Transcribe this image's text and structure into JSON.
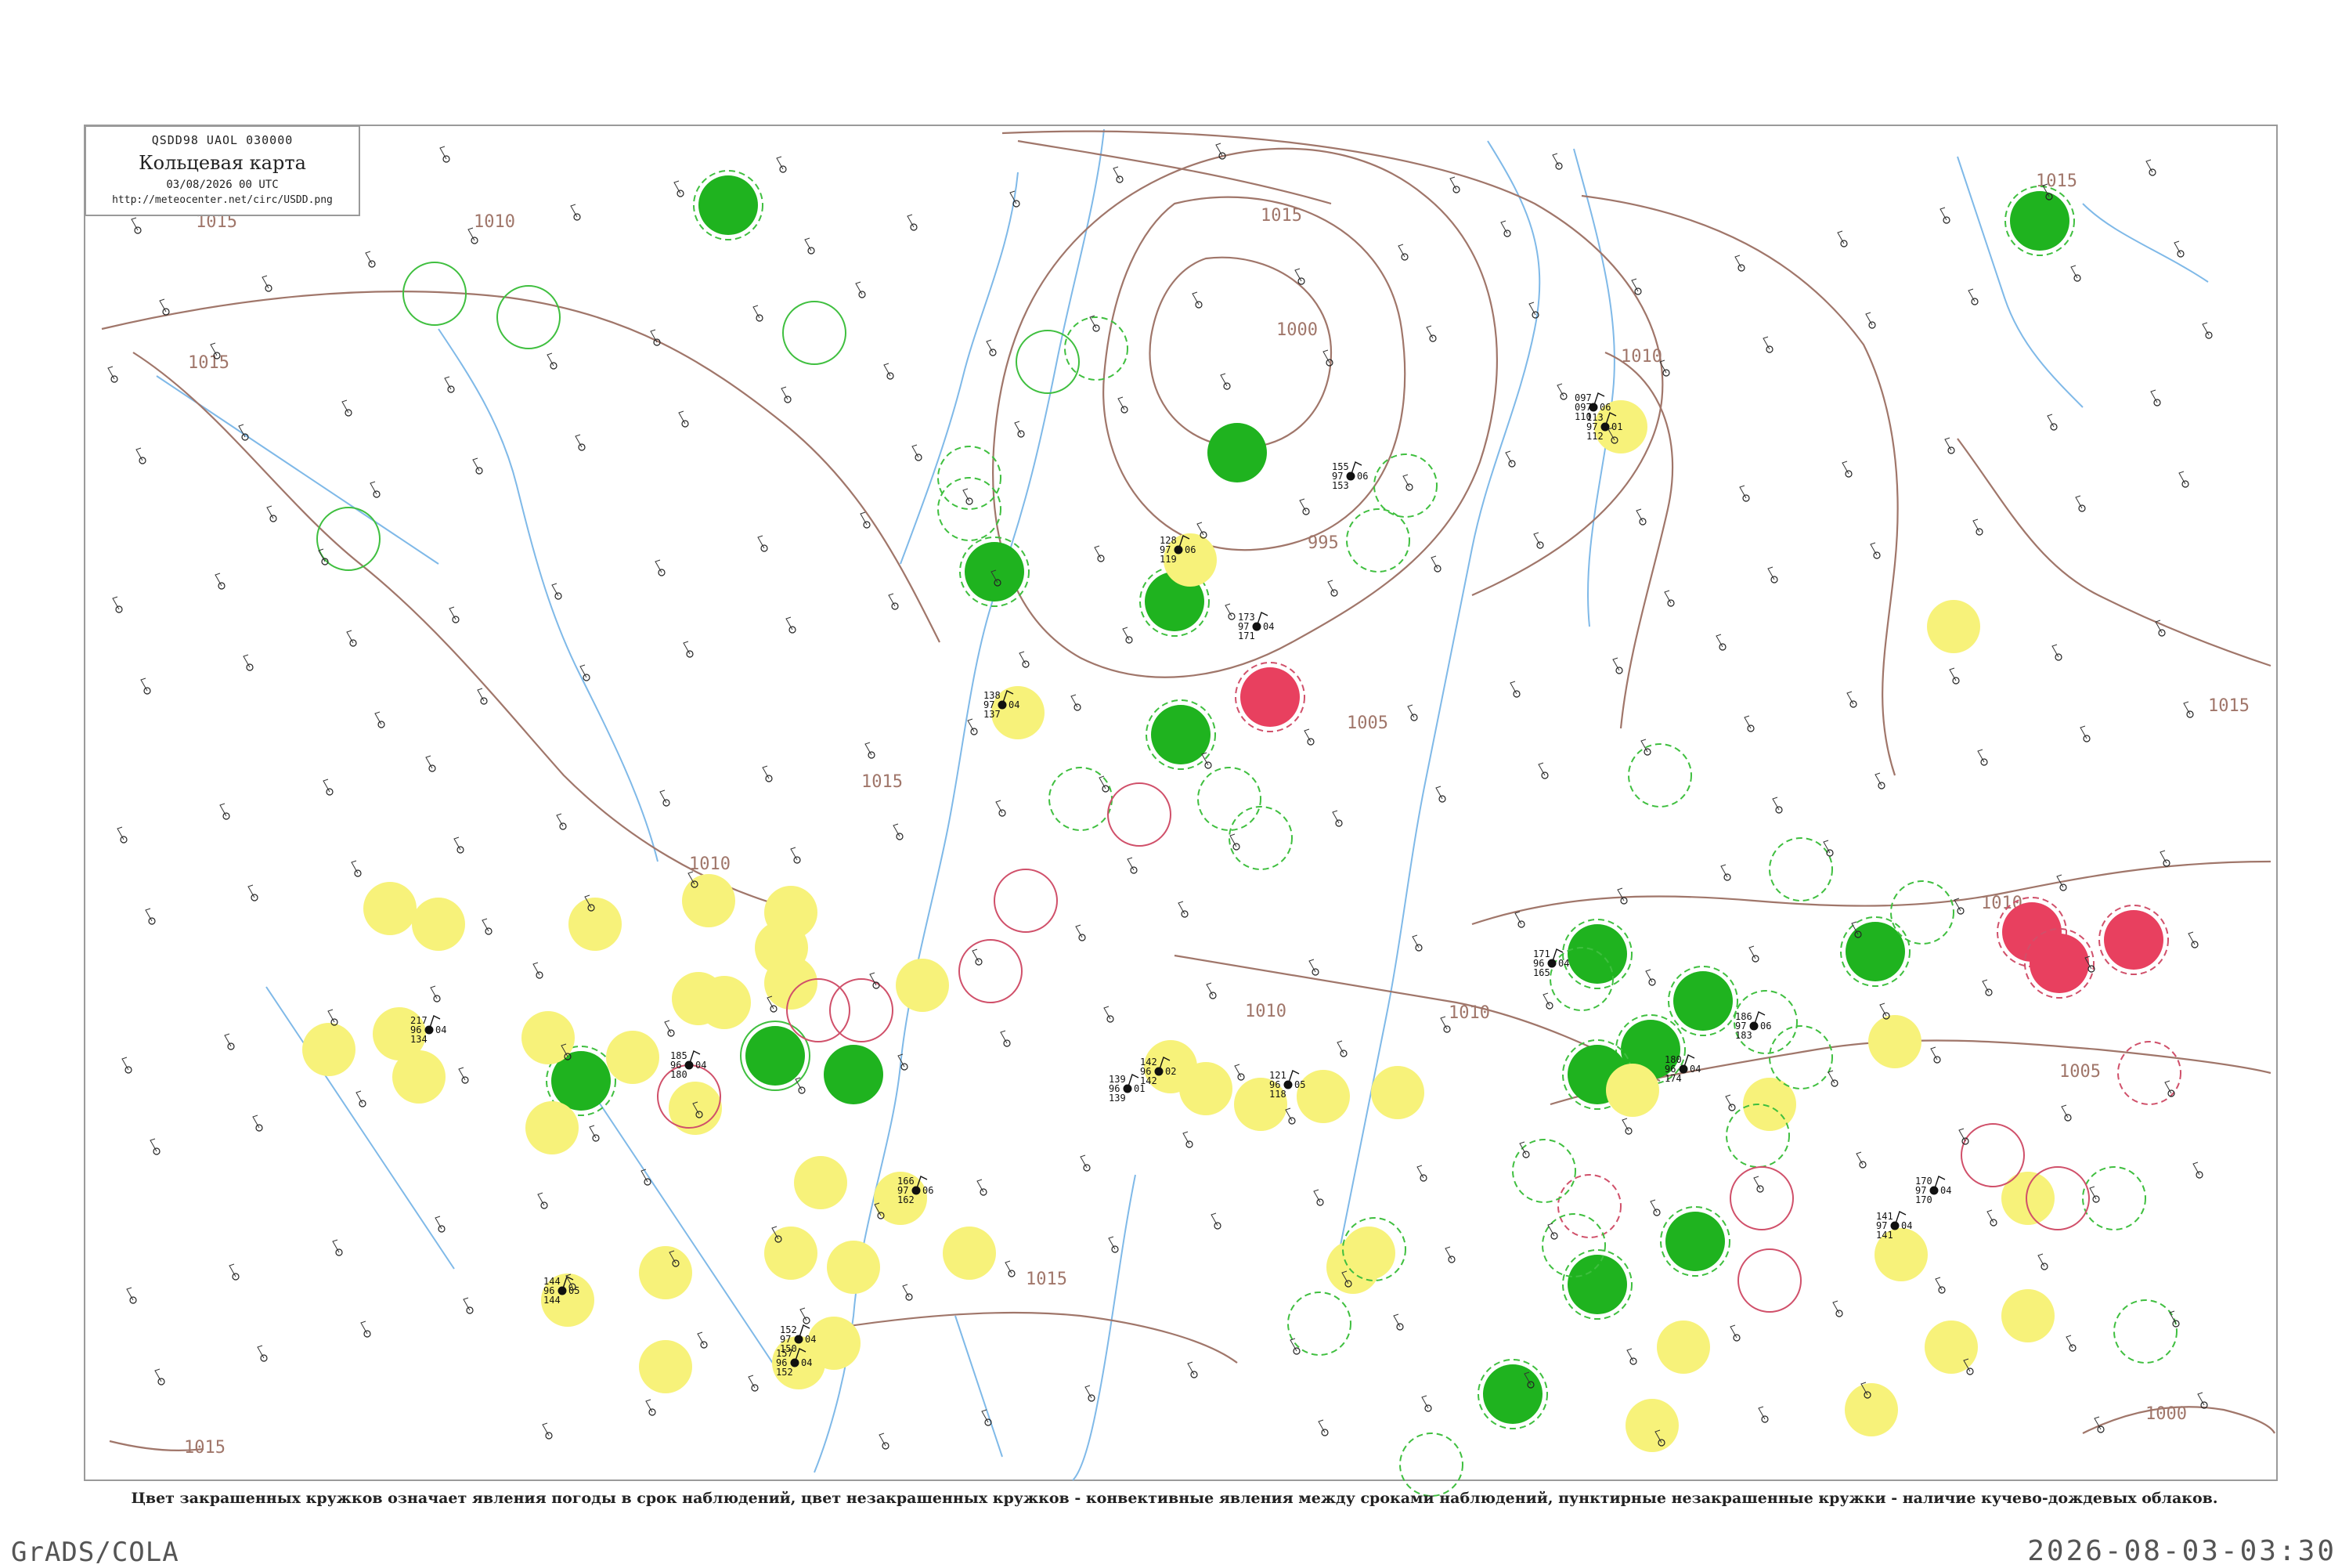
{
  "legend": {
    "code_line": "QSDD98  UAOL  030000",
    "title": "Кольцевая карта",
    "date": "03/08/2026 00 UTC",
    "url": "http://meteocenter.net/circ/USDD.png"
  },
  "caption": "Цвет закрашенных кружков означает явления погоды в срок наблюдений, цвет незакрашенных кружков - конвективные явления между сроками наблюдений, пунктирные незакрашенные кружки - наличие кучево-дождевых облаков.",
  "footer": {
    "left": "GrADS/COLA",
    "right": "2026-08-03-03:30"
  },
  "colors": {
    "isobar": "#a0766a",
    "river": "#7fb9e8",
    "green": "#1fb31f",
    "yellow": "#f7f27a",
    "red": "#e8405f",
    "ring_green": "#3fbf3f",
    "ring_red": "#d0506a",
    "station_text": "#111111",
    "station_name": "#777777"
  },
  "isobar_labels": [
    {
      "text": "1015",
      "id": "iso-1015-tl",
      "pos": "top-left"
    },
    {
      "text": "1015",
      "id": "iso-1015-w",
      "pos": "west"
    },
    {
      "text": "1015",
      "id": "iso-1015-n",
      "pos": "north"
    },
    {
      "text": "1015",
      "id": "iso-1015-ne",
      "pos": "north-east"
    },
    {
      "text": "1015",
      "id": "iso-1015-e",
      "pos": "east"
    },
    {
      "text": "1015",
      "id": "iso-1015-c",
      "pos": "centre-west"
    },
    {
      "text": "1015",
      "id": "iso-1015-s",
      "pos": "south"
    },
    {
      "text": "1015",
      "id": "iso-1015-sw",
      "pos": "south-west"
    },
    {
      "text": "1010",
      "id": "iso-1010-tl",
      "pos": "top-left"
    },
    {
      "text": "1010",
      "id": "iso-1010-n",
      "pos": "north"
    },
    {
      "text": "1010",
      "id": "iso-1010-c",
      "pos": "centre"
    },
    {
      "text": "1010",
      "id": "iso-1010-c2",
      "pos": "centre-east"
    },
    {
      "text": "1010",
      "id": "iso-1010-e",
      "pos": "east"
    },
    {
      "text": "1010",
      "id": "iso-1010-w",
      "pos": "centre-west"
    },
    {
      "text": "1005",
      "id": "iso-1005-c",
      "pos": "centre"
    },
    {
      "text": "1005",
      "id": "iso-1005-e",
      "pos": "east"
    },
    {
      "text": "1000",
      "id": "iso-1000-c",
      "pos": "cyclone"
    },
    {
      "text": "1000",
      "id": "iso-1000-se",
      "pos": "south-east"
    },
    {
      "text": "995",
      "id": "iso-995",
      "pos": "cyclone centre"
    }
  ],
  "stations": [
    {
      "t": "097",
      "p": "097",
      "n": "06",
      "d": "110",
      "name": ""
    },
    {
      "t": "113",
      "p": "97",
      "n": "01",
      "d": "112",
      "name": ""
    },
    {
      "t": "155",
      "p": "97",
      "n": "06",
      "d": "153",
      "name": ""
    },
    {
      "t": "173",
      "p": "97",
      "n": "04",
      "d": "171",
      "name": ""
    },
    {
      "t": "138",
      "p": "97",
      "n": "04",
      "d": "137",
      "name": ""
    },
    {
      "t": "217",
      "p": "96",
      "n": "04",
      "d": "134",
      "name": ""
    },
    {
      "t": "128",
      "p": "97",
      "n": "06",
      "d": "119",
      "name": ""
    },
    {
      "t": "185",
      "p": "96",
      "n": "04",
      "d": "180",
      "name": ""
    },
    {
      "t": "142",
      "p": "96",
      "n": "02",
      "d": "142",
      "name": ""
    },
    {
      "t": "166",
      "p": "97",
      "n": "06",
      "d": "162",
      "name": ""
    },
    {
      "t": "170",
      "p": "97",
      "n": "04",
      "d": "170",
      "name": ""
    },
    {
      "t": "157",
      "p": "96",
      "n": "04",
      "d": "152",
      "name": ""
    },
    {
      "t": "144",
      "p": "96",
      "n": "05",
      "d": "144",
      "name": ""
    },
    {
      "t": "139",
      "p": "96",
      "n": "01",
      "d": "139",
      "name": ""
    },
    {
      "t": "121",
      "p": "96",
      "n": "05",
      "d": "118",
      "name": ""
    },
    {
      "t": "171",
      "p": "96",
      "n": "04",
      "d": "165",
      "name": ""
    },
    {
      "t": "180",
      "p": "96",
      "n": "04",
      "d": "174",
      "name": ""
    },
    {
      "t": "186",
      "p": "97",
      "n": "06",
      "d": "183",
      "name": ""
    },
    {
      "t": "141",
      "p": "97",
      "n": "04",
      "d": "141",
      "name": ""
    },
    {
      "t": "152",
      "p": "97",
      "n": "04",
      "d": "150",
      "name": ""
    }
  ]
}
